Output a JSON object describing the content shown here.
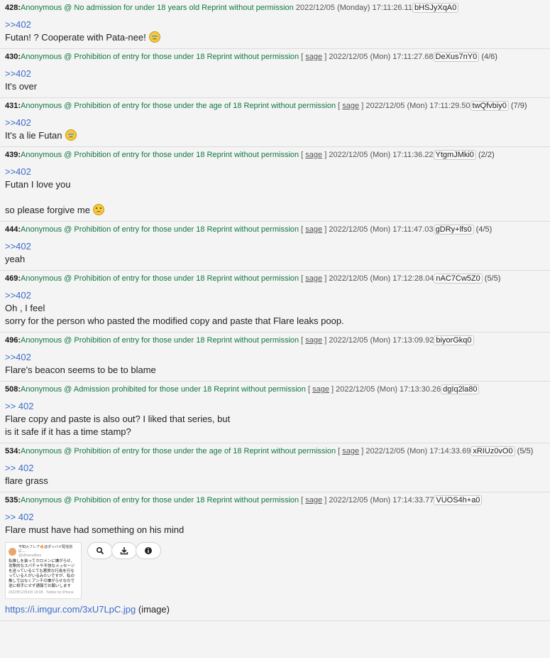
{
  "posts": [
    {
      "num": "428:",
      "name": "Anonymous @ No admission for under 18 years old Reprint without permission",
      "sage": "",
      "date": "2022/12/05 (Monday) 17:11:26.11",
      "id": "bHSJyXqA0",
      "count": "",
      "reply": ">>402",
      "lines": [
        "Futan! ? Cooperate with Pata-nee!"
      ],
      "emoji": "cry"
    },
    {
      "num": "430:",
      "name": "Anonymous @ Prohibition of entry for those under 18 Reprint without permission",
      "sage": "sage",
      "date": "2022/12/05 (Mon) 17:11:27.68",
      "id": "DeXus7nY0",
      "count": "(4/6)",
      "reply": ">>402",
      "lines": [
        "It's over"
      ],
      "emoji": ""
    },
    {
      "num": "431:",
      "name": "Anonymous @ Prohibition of entry for those under the age of 18 Reprint without permission",
      "sage": "sage",
      "date": "2022/12/05 (Mon) 17:11:29.50",
      "id": "twQfvbiy0",
      "count": "(7/9)",
      "reply": ">>402",
      "lines": [
        "It's a lie Futan"
      ],
      "emoji": "cry"
    },
    {
      "num": "439:",
      "name": "Anonymous @ Prohibition of entry for those under 18 Reprint without permission",
      "sage": "sage",
      "date": "2022/12/05 (Mon) 17:11:36.22",
      "id": "YtgmJMki0",
      "count": "(2/2)",
      "reply": ">>402",
      "lines": [
        "Futan I love you",
        "",
        "so please forgive me"
      ],
      "emoji": "sad"
    },
    {
      "num": "444:",
      "name": "Anonymous @ Prohibition of entry for those under 18 Reprint without permission",
      "sage": "sage",
      "date": "2022/12/05 (Mon) 17:11:47.03",
      "id": "gDRy+lfs0",
      "count": "(4/5)",
      "reply": ">>402",
      "lines": [
        "yeah"
      ],
      "emoji": ""
    },
    {
      "num": "469:",
      "name": "Anonymous @ Prohibition of entry for those under 18 Reprint without permission",
      "sage": "sage",
      "date": "2022/12/05 (Mon) 17:12:28.04",
      "id": "nAC7Cw5Z0",
      "count": "(5/5)",
      "reply": ">>402",
      "lines": [
        "Oh , I feel",
        "sorry for the person who pasted the modified copy and paste that Flare leaks poop."
      ],
      "emoji": ""
    },
    {
      "num": "496:",
      "name": "Anonymous @ Prohibition of entry for those under 18 Reprint without permission",
      "sage": "sage",
      "date": "2022/12/05 (Mon) 17:13:09.92",
      "id": "biyorGkq0",
      "count": "",
      "reply": ">>402",
      "lines": [
        "Flare's beacon seems to be to blame"
      ],
      "emoji": ""
    },
    {
      "num": "508:",
      "name": "Anonymous @ Admission prohibited for those under 18 Reprint without permission",
      "sage": "sage",
      "date": "2022/12/05 (Mon) 17:13:30.26",
      "id": "dgIq2la80",
      "count": "",
      "reply": ">> 402",
      "lines": [
        "Flare copy and paste is also out? I liked that series, but",
        "is it safe if it has a time stamp?"
      ],
      "emoji": ""
    },
    {
      "num": "534:",
      "name": "Anonymous @ Prohibition of entry for those under the age of 18 Reprint without permission",
      "sage": "sage",
      "date": "2022/12/05 (Mon) 17:14:33.69",
      "id": "xRIUz0vO0",
      "count": "(5/5)",
      "reply": ">> 402",
      "lines": [
        "flare grass"
      ],
      "emoji": ""
    },
    {
      "num": "535:",
      "name": "Anonymous @ Prohibition of entry for those under 18 Reprint without permission",
      "sage": "sage",
      "date": "2022/12/05 (Mon) 17:14:33.77",
      "id": "VUOS4h+a0",
      "count": "",
      "reply": ">> 402",
      "lines": [
        "Flare must have had something on his mind"
      ],
      "emoji": ""
    }
  ],
  "attachment": {
    "thumb_title": "不知火フレア🔥@ダッバイ配信前に…",
    "thumb_handle": "@shiranuiflare",
    "thumb_text": "私推しを装ってホロメンに嫌がらせ、攻撃的なスパチャや不快なメッセージを送っているとても悪質な行為を行なっている人がいるみたいですが、私の推しではなくアンチの嫌がらせなので逆に相手にせず通報でお願いします",
    "thumb_footer": "2022年12月4日 19:08 · Twitter for iPhone",
    "url": "https://i.imgur.com/3xU7LpC.jpg",
    "suffix": "(image)",
    "buttons": [
      "search-icon",
      "download-icon",
      "info-icon"
    ]
  }
}
